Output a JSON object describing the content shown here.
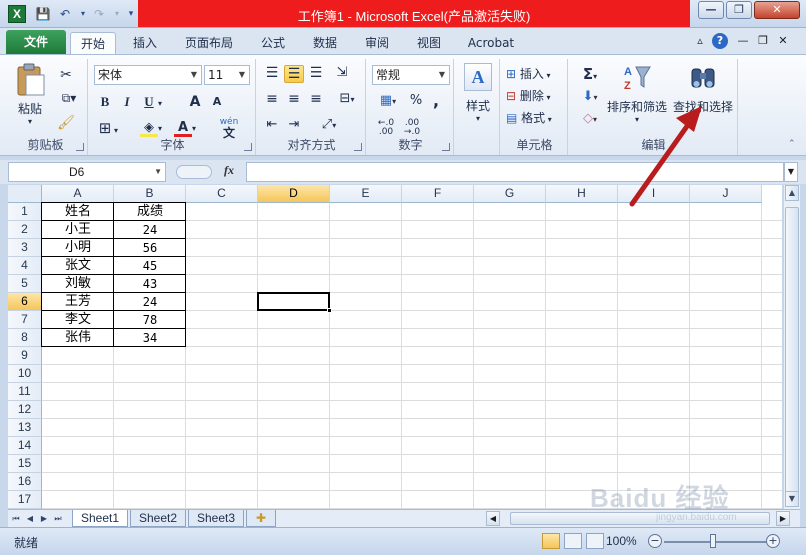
{
  "window": {
    "title": "工作簿1 - Microsoft Excel(产品激活失败)",
    "minimize": "—",
    "restore": "❐",
    "close": "✕"
  },
  "quick_access": {
    "logo": "X",
    "save": "💾",
    "undo": "↶",
    "redo": "↷",
    "customize": "▾"
  },
  "ribbon_tabs": [
    "文件",
    "开始",
    "插入",
    "页面布局",
    "公式",
    "数据",
    "审阅",
    "视图",
    "Acrobat"
  ],
  "ribbon": {
    "clipboard": {
      "label": "剪贴板",
      "paste": "粘贴"
    },
    "font": {
      "label": "字体",
      "name": "宋体",
      "size": "11",
      "bold": "B",
      "italic": "I",
      "underline": "U",
      "grow": "A",
      "shrink": "A",
      "font_color_letter": "A",
      "wen": "wén",
      "wen_char": "文"
    },
    "alignment": {
      "label": "对齐方式"
    },
    "number": {
      "label": "数字",
      "format": "常规",
      "percent": "%",
      "comma": ","
    },
    "styles": {
      "label": "样式"
    },
    "cells": {
      "label": "单元格",
      "insert": "插入",
      "delete": "删除",
      "format": "格式"
    },
    "editing": {
      "label": "编辑",
      "sum": "Σ",
      "sort_filter": "排序和筛选",
      "find_select": "查找和选择"
    }
  },
  "formula_bar": {
    "name_box": "D6",
    "fx": "fx",
    "value": ""
  },
  "columns": [
    "A",
    "B",
    "C",
    "D",
    "E",
    "F",
    "G",
    "H",
    "I",
    "J"
  ],
  "rows": [
    "1",
    "2",
    "3",
    "4",
    "5",
    "6",
    "7",
    "8",
    "9",
    "10",
    "11",
    "12",
    "13",
    "14",
    "15",
    "16",
    "17"
  ],
  "selected_cell": {
    "column": "D",
    "row": "6"
  },
  "table": {
    "header": [
      "姓名",
      "成绩"
    ],
    "rows": [
      [
        "小王",
        "24"
      ],
      [
        "小明",
        "56"
      ],
      [
        "张文",
        "45"
      ],
      [
        "刘敏",
        "43"
      ],
      [
        "王芳",
        "24"
      ],
      [
        "李文",
        "78"
      ],
      [
        "张伟",
        "34"
      ]
    ]
  },
  "sheets": [
    "Sheet1",
    "Sheet2",
    "Sheet3"
  ],
  "active_sheet": "Sheet1",
  "status": {
    "ready": "就绪",
    "zoom": "100%"
  },
  "watermark": {
    "brand": "Baidu 经验",
    "url": "jingyan.baidu.com"
  },
  "colors": {
    "title_highlight": "#ee1c1c",
    "file_tab": "#1f7a3a",
    "annotation_arrow": "#b81c1c",
    "selection_header": "#f5c55b"
  }
}
